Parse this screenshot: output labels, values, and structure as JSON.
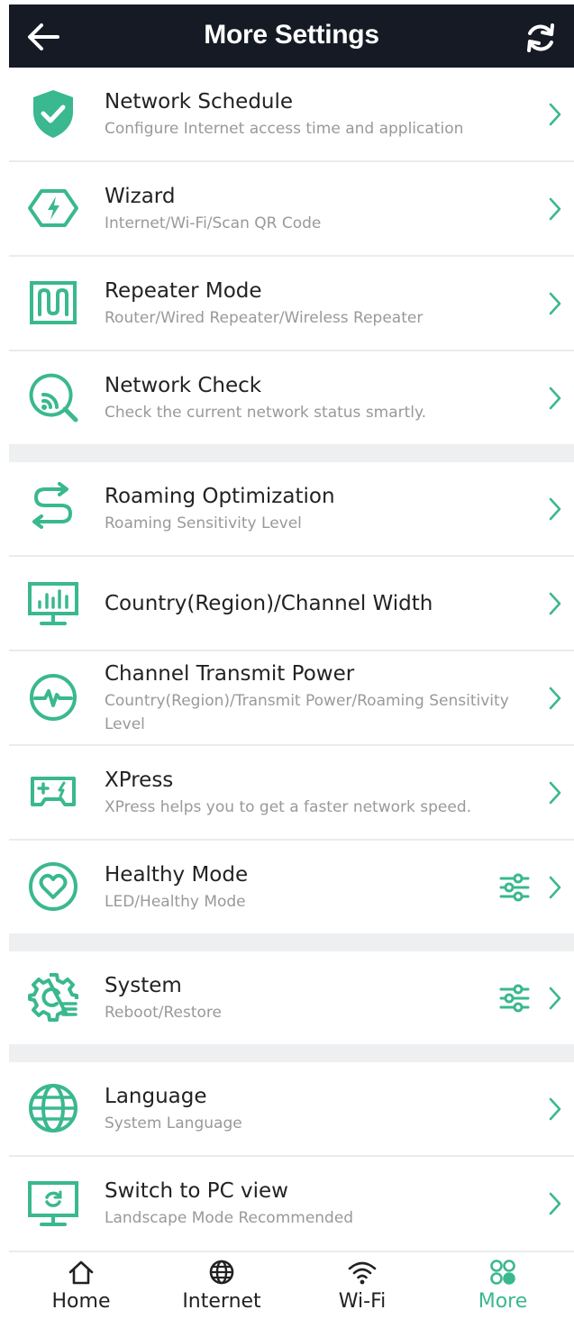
{
  "header": {
    "title": "More Settings",
    "back_icon": "arrow-left-icon",
    "refresh_icon": "refresh-icon"
  },
  "accent_color": "#3ab88f",
  "groups": [
    {
      "items": [
        {
          "id": "network-schedule",
          "icon": "shield-check-icon",
          "title": "Network Schedule",
          "subtitle": "Configure Internet access time and application"
        },
        {
          "id": "wizard",
          "icon": "hexagon-bolt-icon",
          "title": "Wizard",
          "subtitle": "Internet/Wi-Fi/Scan QR Code"
        },
        {
          "id": "repeater-mode",
          "icon": "repeater-icon",
          "title": "Repeater Mode",
          "subtitle": "Router/Wired Repeater/Wireless Repeater"
        },
        {
          "id": "network-check",
          "icon": "network-check-icon",
          "title": "Network Check",
          "subtitle": "Check the current network status smartly."
        }
      ]
    },
    {
      "items": [
        {
          "id": "roaming-optimization",
          "icon": "roaming-icon",
          "title": "Roaming Optimization",
          "subtitle": "Roaming Sensitivity Level"
        },
        {
          "id": "country-channel-width",
          "icon": "monitor-bars-icon",
          "title": "Country(Region)/Channel Width",
          "subtitle": ""
        },
        {
          "id": "channel-transmit-power",
          "icon": "pulse-icon",
          "title": "Channel Transmit Power",
          "subtitle": "Country(Region)/Transmit Power/Roaming Sensitivity Level"
        },
        {
          "id": "xpress",
          "icon": "gamepad-icon",
          "title": "XPress",
          "subtitle": "XPress helps you to get a faster network speed."
        },
        {
          "id": "healthy-mode",
          "icon": "heart-icon",
          "title": "Healthy Mode",
          "subtitle": "LED/Healthy Mode",
          "tune_icon": "sliders-icon"
        }
      ]
    },
    {
      "items": [
        {
          "id": "system",
          "icon": "gear-icon",
          "title": "System",
          "subtitle": "Reboot/Restore",
          "tune_icon": "sliders-icon"
        }
      ]
    },
    {
      "items": [
        {
          "id": "language",
          "icon": "globe-icon",
          "title": "Language",
          "subtitle": "System Language"
        },
        {
          "id": "switch-pc-view",
          "icon": "pc-view-icon",
          "title": "Switch to PC view",
          "subtitle": "Landscape Mode Recommended"
        }
      ]
    }
  ],
  "tabs": [
    {
      "id": "home",
      "icon": "home-icon",
      "label": "Home",
      "active": false
    },
    {
      "id": "internet",
      "icon": "globe-icon",
      "label": "Internet",
      "active": false
    },
    {
      "id": "wifi",
      "icon": "wifi-icon",
      "label": "Wi-Fi",
      "active": false
    },
    {
      "id": "more",
      "icon": "more-icon",
      "label": "More",
      "active": true
    }
  ]
}
